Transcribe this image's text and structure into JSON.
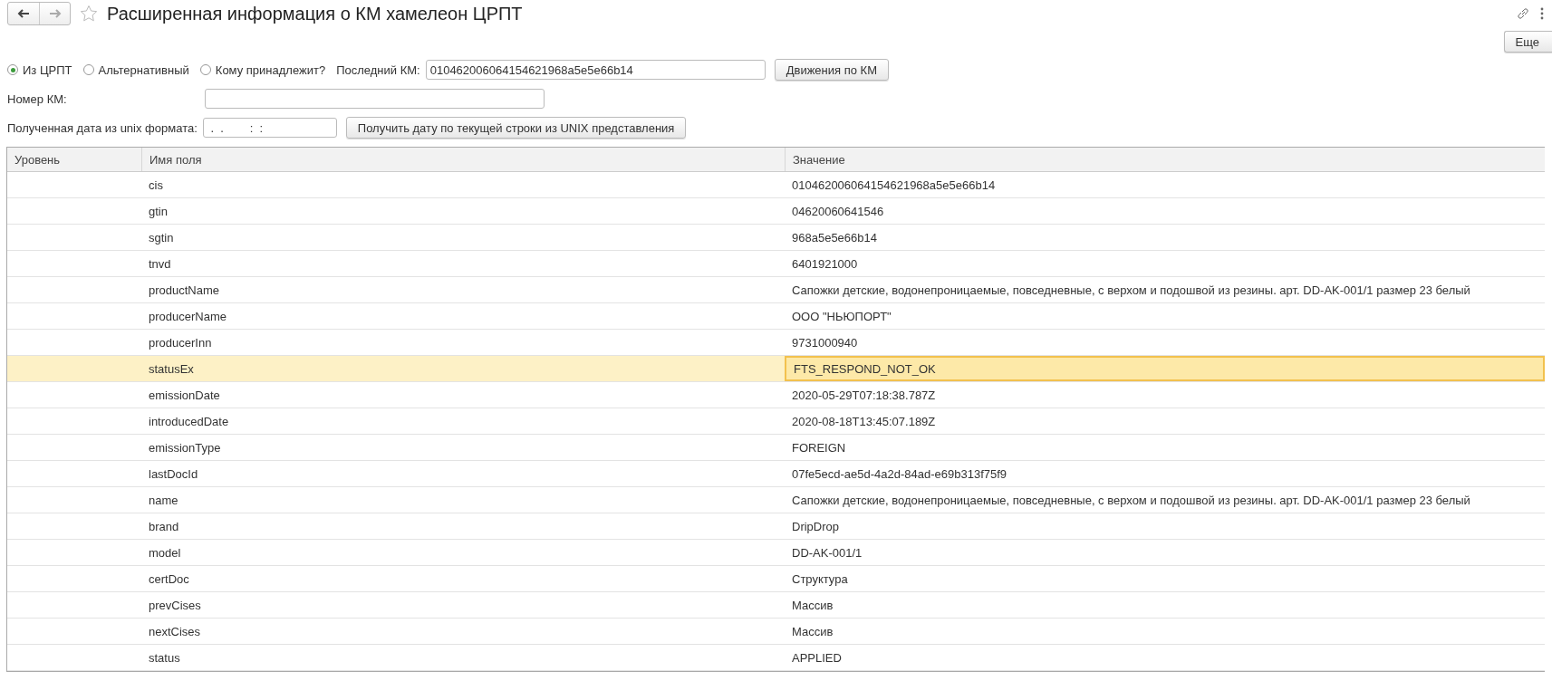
{
  "window": {
    "title": "Расширенная информация о КМ хамелеон ЦРПТ"
  },
  "more_button": "Еще",
  "source_options": [
    {
      "label": "Из ЦРПТ",
      "selected": true
    },
    {
      "label": "Альтернативный",
      "selected": false
    },
    {
      "label": "Кому принадлежит?",
      "selected": false
    }
  ],
  "last_km": {
    "label": "Последний КМ:",
    "value": "010462006064154621968a5e5e66b14"
  },
  "movements_button": "Движения по КМ",
  "km_number": {
    "label": "Номер КМ:"
  },
  "unix_date": {
    "label": "Полученная дата из unix формата:",
    "value": " .  .        :  :"
  },
  "unix_button": "Получить дату по текущей строки из UNIX представления",
  "table": {
    "columns": [
      "Уровень",
      "Имя поля",
      "Значение"
    ],
    "rows": [
      {
        "level": "",
        "field": "cis",
        "value": "010462006064154621968a5e5e66b14",
        "selected": false
      },
      {
        "level": "",
        "field": "gtin",
        "value": "04620060641546",
        "selected": false
      },
      {
        "level": "",
        "field": "sgtin",
        "value": "968a5e5e66b14",
        "selected": false
      },
      {
        "level": "",
        "field": "tnvd",
        "value": "6401921000",
        "selected": false
      },
      {
        "level": "",
        "field": "productName",
        "value": "Сапожки детские, водонепроницаемые, повседневные, с верхом и подошвой из резины. арт. DD-AK-001/1 размер 23 белый",
        "selected": false
      },
      {
        "level": "",
        "field": "producerName",
        "value": "ООО \"НЬЮПОРТ\"",
        "selected": false
      },
      {
        "level": "",
        "field": "producerInn",
        "value": "9731000940",
        "selected": false
      },
      {
        "level": "",
        "field": "statusEx",
        "value": "FTS_RESPOND_NOT_OK",
        "selected": true
      },
      {
        "level": "",
        "field": "emissionDate",
        "value": "2020-05-29T07:18:38.787Z",
        "selected": false
      },
      {
        "level": "",
        "field": "introducedDate",
        "value": "2020-08-18T13:45:07.189Z",
        "selected": false
      },
      {
        "level": "",
        "field": "emissionType",
        "value": "FOREIGN",
        "selected": false
      },
      {
        "level": "",
        "field": "lastDocId",
        "value": "07fe5ecd-ae5d-4a2d-84ad-e69b313f75f9",
        "selected": false
      },
      {
        "level": "",
        "field": "name",
        "value": "Сапожки детские, водонепроницаемые, повседневные, с верхом и подошвой из резины. арт. DD-AK-001/1 размер 23 белый",
        "selected": false
      },
      {
        "level": "",
        "field": "brand",
        "value": "DripDrop",
        "selected": false
      },
      {
        "level": "",
        "field": "model",
        "value": "DD-AK-001/1",
        "selected": false
      },
      {
        "level": "",
        "field": "certDoc",
        "value": "Структура",
        "selected": false
      },
      {
        "level": "",
        "field": "prevCises",
        "value": "Массив",
        "selected": false
      },
      {
        "level": "",
        "field": "nextCises",
        "value": "Массив",
        "selected": false
      },
      {
        "level": "",
        "field": "status",
        "value": "APPLIED",
        "selected": false
      }
    ]
  }
}
